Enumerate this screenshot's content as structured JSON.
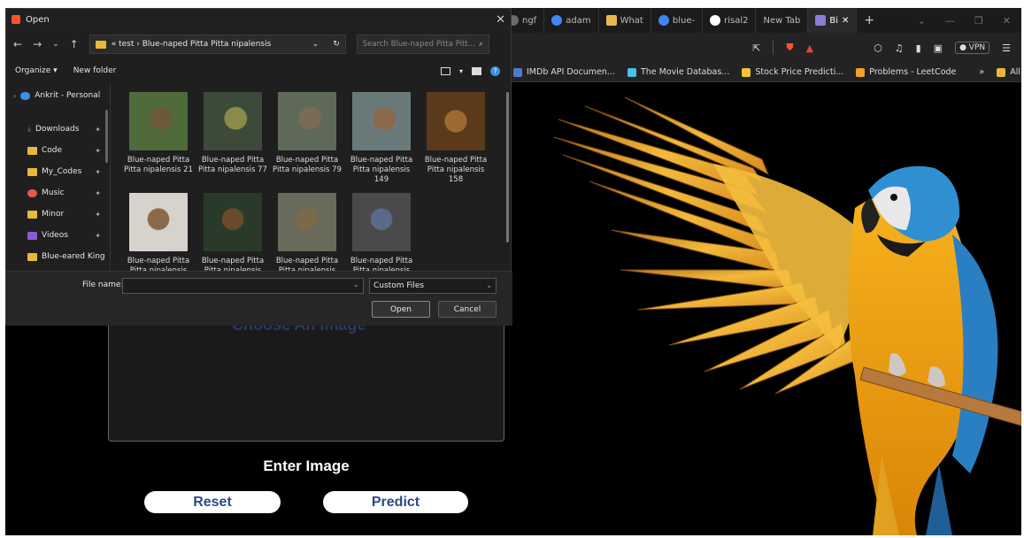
{
  "browser": {
    "tabs": [
      {
        "label": "ngf",
        "color": "#6a6a6a"
      },
      {
        "label": "adam",
        "color": "#4285f4"
      },
      {
        "label": "What",
        "color": "#e8b84b"
      },
      {
        "label": "blue-",
        "color": "#4285f4"
      },
      {
        "label": "risal2",
        "color": "#ffffff"
      },
      {
        "label": "New Tab",
        "color": ""
      },
      {
        "label": "Bi",
        "color": "#8e7bd8"
      }
    ],
    "new_tab": "+",
    "vpn_label": "VPN",
    "bookmarks": [
      {
        "label": "IMDb API Documen...",
        "color": "#4a7bd1"
      },
      {
        "label": "The Movie Databas...",
        "color": "#4cc0e6"
      },
      {
        "label": "Stock Price Predicti...",
        "color": "#f2c230"
      },
      {
        "label": "Problems - LeetCode",
        "color": "#f2a12b"
      }
    ],
    "more": "»",
    "all_bookmarks": "All Bookmarks"
  },
  "page": {
    "upload_text": "Choose An Image",
    "enter_image": "Enter Image",
    "reset_label": "Reset",
    "predict_label": "Predict"
  },
  "dialog": {
    "title": "Open",
    "close": "✕",
    "breadcrumb": "« test › Blue-naped Pitta Pitta nipalensis",
    "search_placeholder": "Search Blue-naped Pitta Pitt...",
    "organize": "Organize ▾",
    "new_folder": "New folder",
    "sidebar": [
      {
        "label": "Ankrit - Personal",
        "icon": "cloud-icon",
        "color": "#3b8ee6"
      },
      {
        "label": "Downloads",
        "icon": "download-icon",
        "color": "#3b8ee6",
        "pin": true
      },
      {
        "label": "Code",
        "icon": "folder-icon",
        "color": "#e9b73b",
        "pin": true
      },
      {
        "label": "My_Codes",
        "icon": "folder-icon",
        "color": "#e9b73b",
        "pin": true
      },
      {
        "label": "Music",
        "icon": "music-icon",
        "color": "#e15a4a",
        "pin": true
      },
      {
        "label": "Minor",
        "icon": "folder-icon",
        "color": "#e9b73b",
        "pin": true
      },
      {
        "label": "Videos",
        "icon": "video-icon",
        "color": "#8a5ad8",
        "pin": true
      },
      {
        "label": "Blue-eared King",
        "icon": "folder-icon",
        "color": "#e9b73b"
      }
    ],
    "files": [
      {
        "name": "Blue-naped Pitta Pitta nipalensis 21",
        "tone": "#6b5a3a",
        "bg": "#4f6b3a"
      },
      {
        "name": "Blue-naped Pitta Pitta nipalensis 77",
        "tone": "#8a8a4a",
        "bg": "#3c4a3a"
      },
      {
        "name": "Blue-naped Pitta Pitta nipalensis 79",
        "tone": "#7a6a58",
        "bg": "#5d6a58"
      },
      {
        "name": "Blue-naped Pitta Pitta nipalensis 149",
        "tone": "#8a6a4a",
        "bg": "#6a7a7a"
      },
      {
        "name": "Blue-naped Pitta Pitta nipalensis 158",
        "tone": "#9a6a30",
        "bg": "#5a3a1a"
      },
      {
        "name": "Blue-naped Pitta Pitta nipalensis",
        "tone": "#8a6a4a",
        "bg": "#d6d2cc"
      },
      {
        "name": "Blue-naped Pitta Pitta nipalensis",
        "tone": "#6a4a2a",
        "bg": "#2a3a2a"
      },
      {
        "name": "Blue-naped Pitta Pitta nipalensis",
        "tone": "#7a6a4a",
        "bg": "#6a6a5a"
      },
      {
        "name": "Blue-naped Pitta Pitta nipalensis",
        "tone": "#5a6a8a",
        "bg": "#4a4a4a"
      }
    ],
    "file_name_label": "File name:",
    "file_name_value": "",
    "filter_label": "Custom Files",
    "open_label": "Open",
    "cancel_label": "Cancel"
  }
}
